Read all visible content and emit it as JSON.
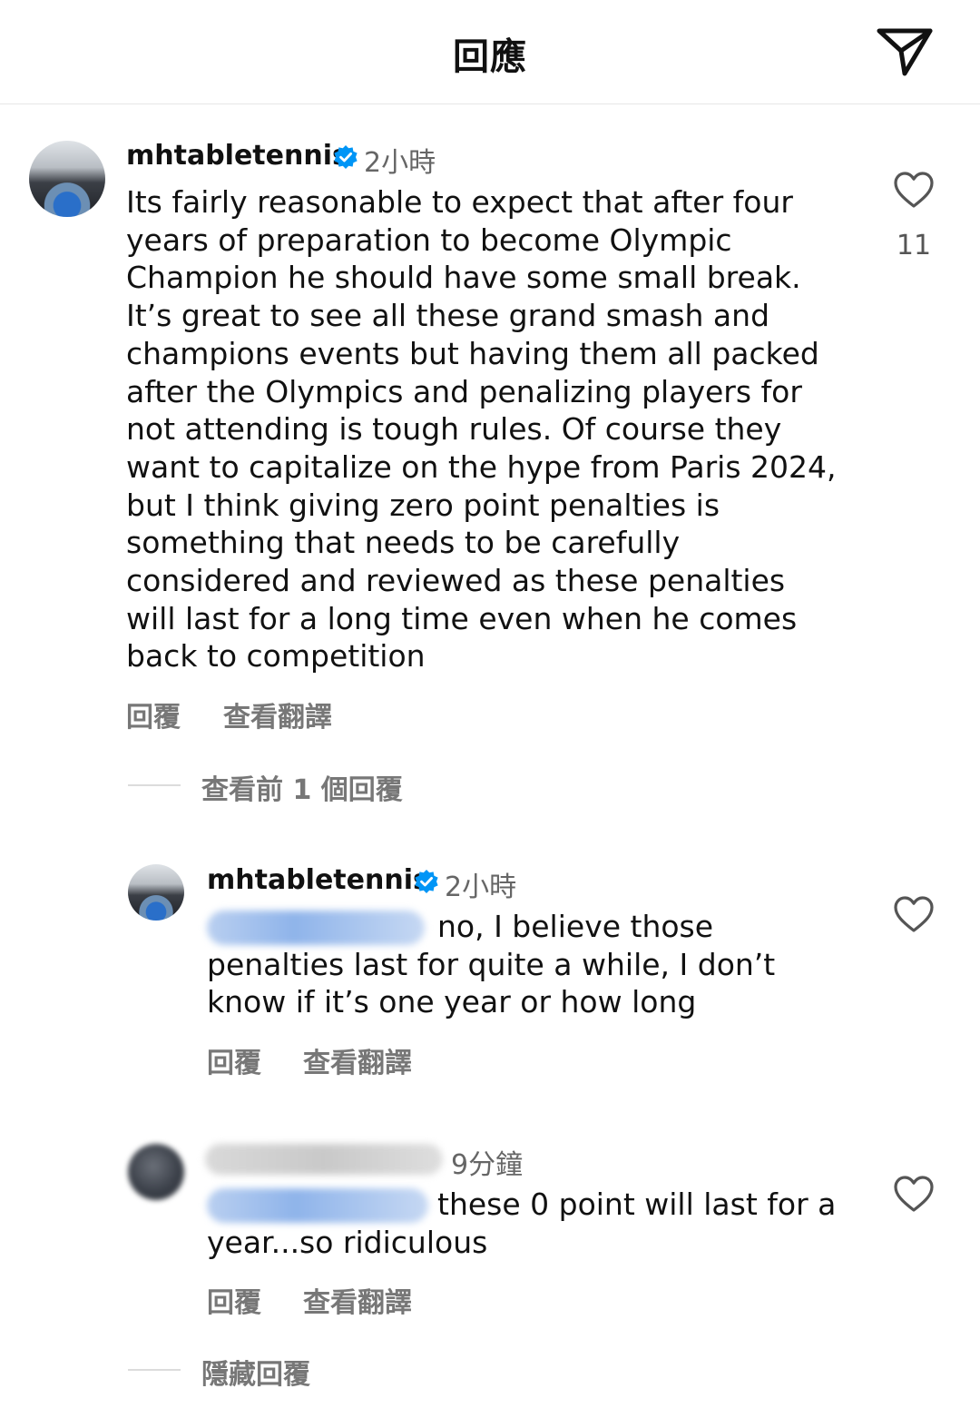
{
  "header": {
    "title": "回應",
    "send_icon": "paper-plane-icon"
  },
  "comments": [
    {
      "username": "mhtabletennis",
      "verified": true,
      "time": "2小時",
      "lines": [
        "Its fairly reasonable to expect that after four",
        "years of preparation to become Olympic",
        "Champion he should have some small break.",
        "It’s great to see all these grand smash and",
        "champions events but having them all packed",
        "after the Olympics and penalizing players for",
        "not attending is tough rules. Of course they",
        "want to capitalize on the hype from Paris 2024,",
        "but I think giving zero point penalties is",
        "something that needs to be carefully",
        "considered and reviewed as these penalties",
        "will last for a long time even when he comes",
        "back to competition"
      ],
      "reply_label": "回覆",
      "translate_label": "查看翻譯",
      "like_count": "11"
    }
  ],
  "view_previous_replies": "查看前 1 個回覆",
  "replies": [
    {
      "username": "mhtabletennis",
      "verified": true,
      "time": "2小時",
      "first_line_after_mention": "no, I believe those",
      "lines": [
        "penalties last for quite a while, I don’t",
        "know if it’s one year or how long"
      ],
      "reply_label": "回覆",
      "translate_label": "查看翻譯"
    },
    {
      "time": "9分鐘",
      "first_line_after_mention": "these 0 point will last for a",
      "lines": [
        "year...so ridiculous"
      ],
      "reply_label": "回覆",
      "translate_label": "查看翻譯"
    }
  ],
  "hide_replies": "隱藏回覆",
  "colors": {
    "verified_blue": "#0095f6",
    "muted_text": "#777777",
    "divider": "#e6e6e6"
  }
}
